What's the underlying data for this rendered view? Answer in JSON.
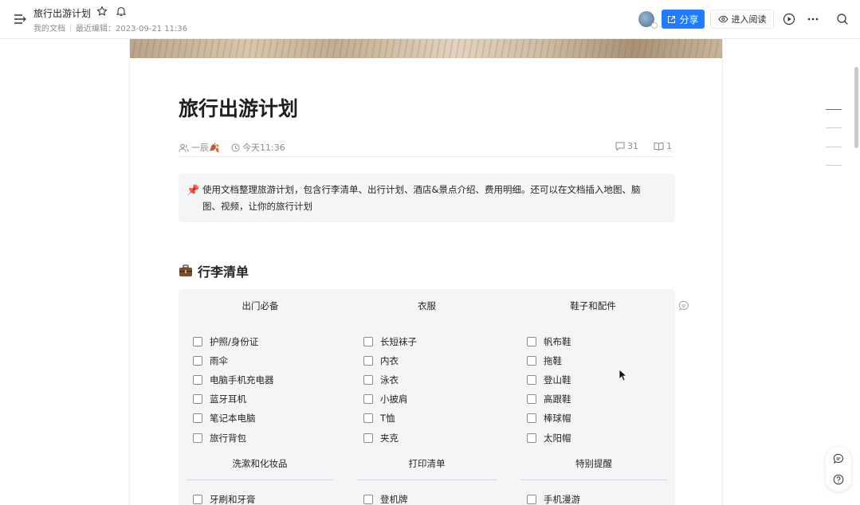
{
  "header": {
    "doc_title": "旅行出游计划",
    "location": "我的文档",
    "last_edited": "最近编辑：2023-09-21 11:36",
    "share_label": "分享",
    "read_label": "进入阅读"
  },
  "page": {
    "title": "旅行出游计划",
    "author": "一辰🍂",
    "time": "今天11:36",
    "comment_count": "31",
    "read_count": "1",
    "callout_icon": "📌",
    "callout_text": "使用文档整理旅游计划，包含行李清单、出行计划、酒店&景点介绍、费用明细。还可以在文档插入地图、脑图、视频，让你的旅行计划"
  },
  "luggage": {
    "heading": "行李清单",
    "columns": [
      {
        "title": "出门必备",
        "items": [
          "护照/身份证",
          "雨伞",
          "电脑手机充电器",
          "蓝牙耳机",
          "笔记本电脑",
          "旅行背包"
        ]
      },
      {
        "title": "衣服",
        "items": [
          "长短袜子",
          "内衣",
          "泳衣",
          "小披肩",
          "T恤",
          "夹克"
        ]
      },
      {
        "title": "鞋子和配件",
        "items": [
          "帆布鞋",
          "拖鞋",
          "登山鞋",
          "高跟鞋",
          "棒球帽",
          "太阳帽"
        ]
      }
    ],
    "columns2": [
      {
        "title": "洗漱和化妆品",
        "items": [
          "牙刷和牙膏"
        ]
      },
      {
        "title": "打印清单",
        "items": [
          "登机牌"
        ]
      },
      {
        "title": "特别提醒",
        "items": [
          "手机漫游"
        ]
      }
    ]
  },
  "colors": {
    "accent": "#1f7bff",
    "block_bg": "#f4f5f7"
  },
  "icons": [
    "menu-icon",
    "star-icon",
    "bell-icon",
    "share-icon",
    "eye-icon",
    "play-icon",
    "more-icon",
    "search-icon",
    "user-icon",
    "clock-icon",
    "comment-icon",
    "book-icon",
    "pin-icon",
    "suitcase-icon",
    "chat-icon",
    "help-icon"
  ]
}
